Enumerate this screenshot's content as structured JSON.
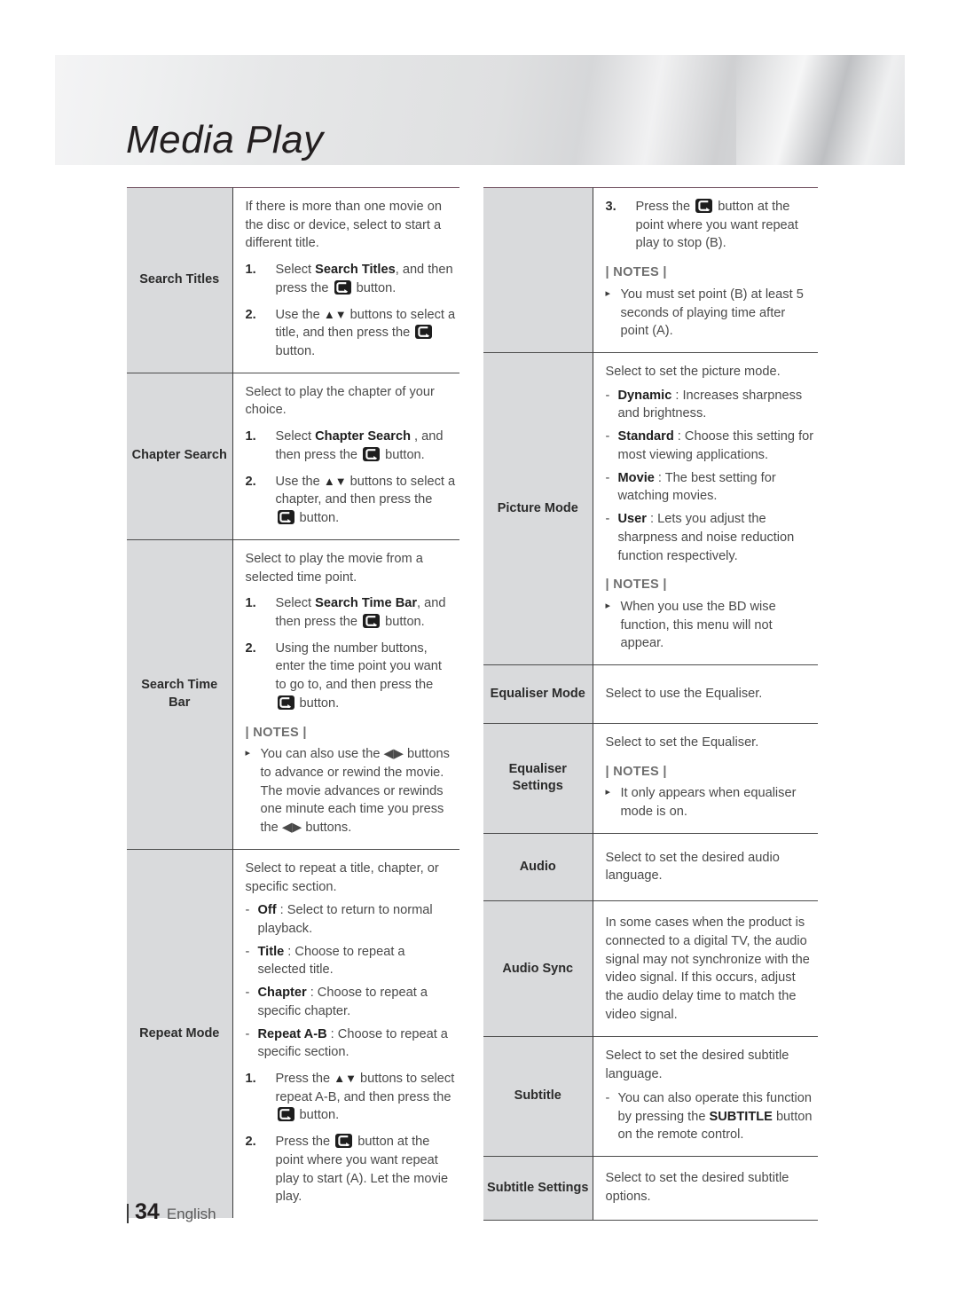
{
  "page": {
    "title": "Media Play",
    "page_number": "34",
    "language": "English",
    "notes_heading": "| NOTES |",
    "enter_button_icon": "enter-button-icon",
    "updown_arrows": "▲▼",
    "leftright_arrows": "◀▶",
    "note_bullet": "▸",
    "dash_bullet": "-"
  },
  "left_table": {
    "rows": [
      {
        "label": "Search Titles",
        "intro": "If there is more than one movie on the disc or device, select to start a different title.",
        "steps": [
          {
            "num": "1.",
            "parts": [
              "Select ",
              "Search Titles",
              ", and then press the ",
              "ICON",
              " button."
            ]
          },
          {
            "num": "2.",
            "parts": [
              "Use the ",
              "ARROWS_UD",
              " buttons to select a title, and then press the ",
              "ICON",
              " button."
            ]
          }
        ]
      },
      {
        "label": "Chapter Search",
        "intro": "Select to play the chapter of your choice.",
        "steps": [
          {
            "num": "1.",
            "parts": [
              "Select ",
              "Chapter Search",
              " , and then press the ",
              "ICON",
              " button."
            ]
          },
          {
            "num": "2.",
            "parts": [
              "Use the ",
              "ARROWS_UD",
              " buttons to select a chapter, and then press the ",
              "ICON",
              " button."
            ]
          }
        ]
      },
      {
        "label": "Search Time Bar",
        "intro": "Select to play the movie from a selected time point.",
        "steps": [
          {
            "num": "1.",
            "parts": [
              "Select ",
              "Search Time Bar",
              ", and then press the ",
              "ICON",
              " button."
            ]
          },
          {
            "num": "2.",
            "parts": [
              "Using the number buttons, enter the time point you want to go to, and then press the ",
              "ICON",
              " button."
            ]
          }
        ],
        "notes": [
          "You can also use the ◀▶ buttons to advance or rewind the movie. The movie advances or rewinds one minute each time you press the ◀▶ buttons."
        ]
      },
      {
        "label": "Repeat Mode",
        "intro": "Select to repeat a title, chapter, or specific section.",
        "dashes": [
          {
            "term": "Off",
            "text": " : Select to return to normal playback."
          },
          {
            "term": "Title",
            "text": " : Choose to repeat a selected title."
          },
          {
            "term": "Chapter",
            "text": " : Choose to repeat a specific chapter."
          },
          {
            "term": "Repeat A-B",
            "text": " : Choose to repeat a specific section."
          }
        ],
        "steps": [
          {
            "num": "1.",
            "parts": [
              "Press the ",
              "ARROWS_UD",
              " buttons to select repeat A-B, and then press the ",
              "ICON",
              " button."
            ]
          },
          {
            "num": "2.",
            "parts": [
              "Press the ",
              "ICON",
              " button at the point where you want repeat play to start (A). Let the movie play."
            ]
          }
        ]
      }
    ]
  },
  "right_table": {
    "rows": [
      {
        "label": "",
        "steps": [
          {
            "num": "3.",
            "parts": [
              "Press the ",
              "ICON",
              " button at the point where you want repeat play to stop (B)."
            ]
          }
        ],
        "notes": [
          "You must set point (B) at least 5 seconds of playing time after point (A)."
        ]
      },
      {
        "label": "Picture Mode",
        "intro": "Select to set the picture mode.",
        "dashes": [
          {
            "term": "Dynamic",
            "text": " : Increases sharpness and brightness."
          },
          {
            "term": "Standard",
            "text": " : Choose this setting for most viewing applications."
          },
          {
            "term": "Movie",
            "text": " : The best setting for watching movies."
          },
          {
            "term": "User",
            "text": " : Lets you adjust the sharpness and noise reduction function respectively."
          }
        ],
        "notes": [
          "When you use the BD wise function, this menu will not appear."
        ]
      },
      {
        "label": "Equaliser Mode",
        "intro": "Select to use the Equaliser."
      },
      {
        "label": "Equaliser Settings",
        "intro": "Select to set the Equaliser.",
        "notes": [
          "It only appears when equaliser mode is on."
        ]
      },
      {
        "label": "Audio",
        "intro": "Select to set the desired audio language."
      },
      {
        "label": "Audio Sync",
        "intro": "In some cases when the product is connected to a digital TV, the audio signal may not synchronize with the video signal. If this occurs, adjust the audio delay time to match the video signal."
      },
      {
        "label": "Subtitle",
        "intro": "Select to set the desired subtitle language.",
        "dashes": [
          {
            "term": "",
            "text": "You can also operate this function by pressing the SUBTITLE button on the remote control.",
            "bold_inline": "SUBTITLE"
          }
        ]
      },
      {
        "label": "Subtitle Settings",
        "intro": "Select to set the desired subtitle options."
      }
    ]
  }
}
